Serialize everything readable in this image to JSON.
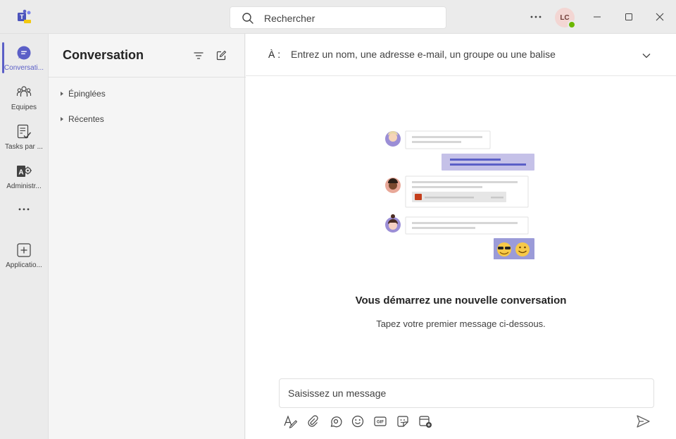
{
  "window": {
    "app_icon": "teams-icon",
    "search_placeholder": "Rechercher",
    "more_icon": "more-horizontal-icon",
    "user_initials": "LC",
    "controls": [
      "minimize-icon",
      "maximize-icon",
      "close-icon"
    ]
  },
  "rail": {
    "items": [
      {
        "label": "Conversati...",
        "icon": "chat-icon",
        "active": true
      },
      {
        "label": "Équipes",
        "icon": "teams-people-icon",
        "active": false
      },
      {
        "label": "Tasks par ...",
        "icon": "tasks-icon",
        "active": false
      },
      {
        "label": "Administr...",
        "icon": "admin-icon",
        "active": false
      },
      {
        "label": "Applicatio...",
        "icon": "add-apps-icon",
        "active": false
      }
    ],
    "more_icon": "more-horizontal-icon"
  },
  "list_panel": {
    "title": "Conversation",
    "sections": [
      {
        "label": "Épinglées"
      },
      {
        "label": "Récentes"
      }
    ]
  },
  "main": {
    "to_label": "À :",
    "to_placeholder": "Entrez un nom, une adresse e-mail, un groupe ou une balise",
    "empty_title": "Vous démarrez une nouvelle conversation",
    "empty_subtitle": "Tapez votre premier message ci-dessous.",
    "composer_placeholder": "Saisissez un message",
    "toolbar_icons": [
      "format-icon",
      "attach-icon",
      "loop-icon",
      "emoji-icon",
      "gif-icon",
      "sticker-icon",
      "schedule-meeting-icon"
    ],
    "send_icon": "send-icon"
  },
  "colors": {
    "accent": "#5b5fc7",
    "presence": "#6bb700"
  }
}
